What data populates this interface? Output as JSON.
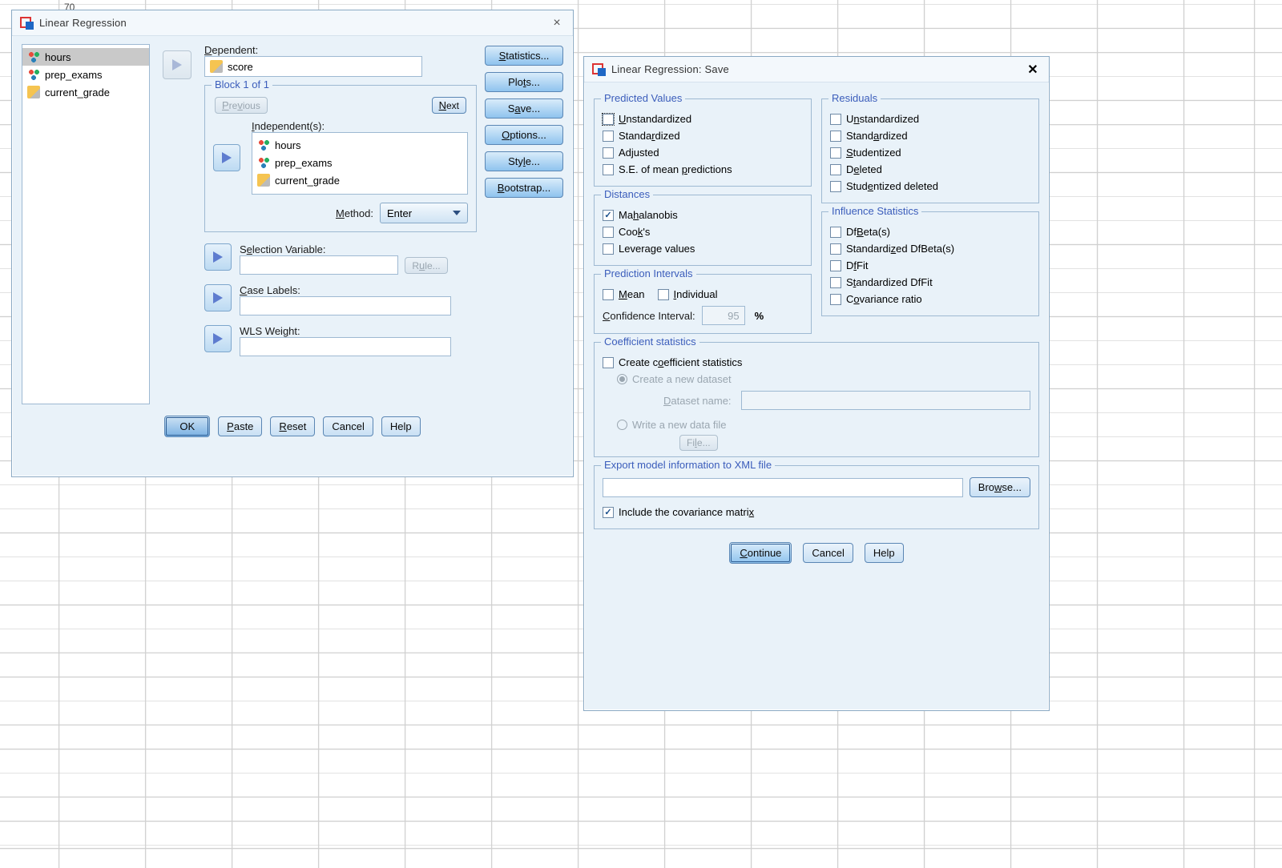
{
  "page_number_top": "70",
  "reg": {
    "title": "Linear Regression",
    "vars": [
      {
        "name": "hours",
        "type": "nominal",
        "selected": true
      },
      {
        "name": "prep_exams",
        "type": "nominal",
        "selected": false
      },
      {
        "name": "current_grade",
        "type": "scale",
        "selected": false
      }
    ],
    "dependent_label": "Dependent:",
    "dependent_val": "score",
    "block_label": "Block 1 of 1",
    "prev": "Previous",
    "next": "Next",
    "independent_label": "Independent(s):",
    "independents": [
      {
        "name": "hours",
        "type": "nominal"
      },
      {
        "name": "prep_exams",
        "type": "nominal"
      },
      {
        "name": "current_grade",
        "type": "scale"
      }
    ],
    "method_label": "Method:",
    "method_val": "Enter",
    "sel_var_label": "Selection Variable:",
    "rule": "Rule...",
    "case_labels": "Case Labels:",
    "wls_weight": "WLS Weight:",
    "buttons": {
      "ok": "OK",
      "paste": "Paste",
      "reset": "Reset",
      "cancel": "Cancel",
      "help": "Help"
    },
    "side": {
      "stats": "Statistics...",
      "plots": "Plots...",
      "save": "Save...",
      "options": "Options...",
      "style": "Style...",
      "boot": "Bootstrap..."
    }
  },
  "save": {
    "title": "Linear Regression: Save",
    "predicted": {
      "legend": "Predicted Values",
      "unstd": "Unstandardized",
      "std": "Standardized",
      "adj": "Adjusted",
      "se": "S.E. of mean predictions"
    },
    "residuals": {
      "legend": "Residuals",
      "unstd": "Unstandardized",
      "std": "Standardized",
      "stud": "Studentized",
      "del": "Deleted",
      "studdel": "Studentized deleted"
    },
    "dist": {
      "legend": "Distances",
      "mahal": "Mahalanobis",
      "cooks": "Cook's",
      "lev": "Leverage values"
    },
    "infl": {
      "legend": "Influence Statistics",
      "dfbeta": "DfBeta(s)",
      "sdfbeta": "Standardized DfBeta(s)",
      "dffit": "DfFit",
      "sdffit": "Standardized DfFit",
      "cov": "Covariance ratio"
    },
    "pred_int": {
      "legend": "Prediction Intervals",
      "mean": "Mean",
      "indiv": "Individual",
      "ci_label": "Confidence Interval:",
      "ci_val": "95",
      "pct": "%"
    },
    "coef": {
      "legend": "Coefficient statistics",
      "create": "Create coefficient statistics",
      "new_ds": "Create a new dataset",
      "ds_name": "Dataset name:",
      "write_file": "Write a new data file",
      "file_btn": "File..."
    },
    "xml": {
      "legend": "Export model information to XML file",
      "browse": "Browse...",
      "include_cov": "Include the covariance matrix"
    },
    "buttons": {
      "continue": "Continue",
      "cancel": "Cancel",
      "help": "Help"
    },
    "checked": {
      "mahal": true,
      "include_cov": true
    }
  }
}
